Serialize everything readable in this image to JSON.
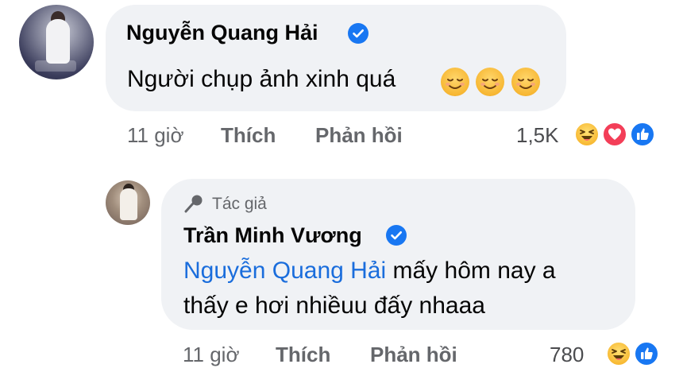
{
  "comment": {
    "author": "Nguyễn Quang Hải",
    "text": "Người chụp ảnh xinh quá",
    "emojis": [
      "relieved-face-icon",
      "relieved-face-icon",
      "relieved-face-icon"
    ],
    "time": "11 giờ",
    "like_label": "Thích",
    "reply_label": "Phản hồi",
    "reaction_count": "1,5K",
    "reactions": [
      "haha-reaction-icon",
      "love-reaction-icon",
      "like-reaction-icon"
    ]
  },
  "reply": {
    "author_badge": "Tác giả",
    "author": "Trần Minh Vương",
    "mention": "Nguyễn Quang Hải",
    "text_line1": " mấy hôm nay a",
    "text_line2": "thấy e hơi nhiều​u đấy nhaaa",
    "time": "11 giờ",
    "like_label": "Thích",
    "reply_label": "Phản hồi",
    "reaction_count": "780",
    "reactions": [
      "haha-reaction-icon",
      "like-reaction-icon"
    ]
  },
  "colors": {
    "bubble": "#f0f2f5",
    "verified": "#1877f2",
    "mention": "#1a6ddc",
    "meta": "#65676b"
  }
}
